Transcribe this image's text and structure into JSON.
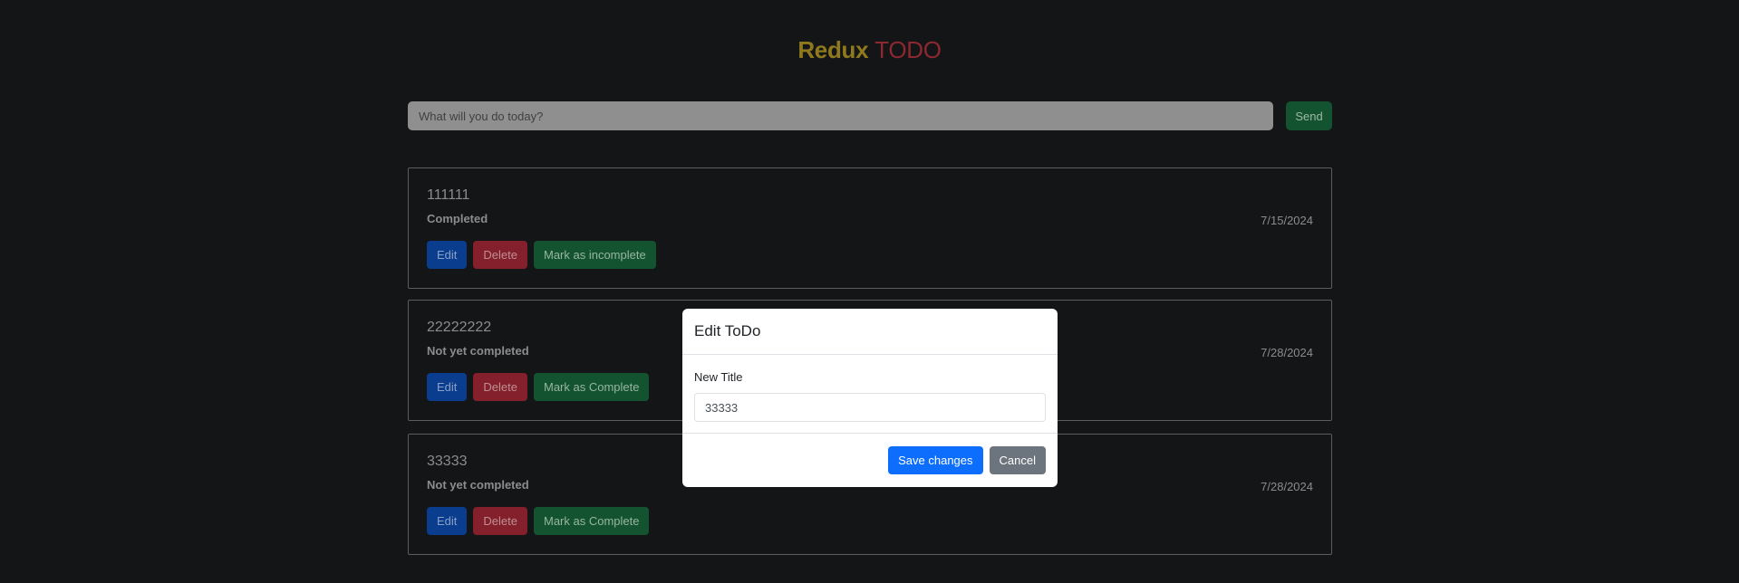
{
  "header": {
    "title_word1": "Redux",
    "title_word2": "TODO"
  },
  "add_form": {
    "placeholder": "What will you do today?",
    "value": "",
    "send_label": "Send"
  },
  "todos": [
    {
      "title": "111111",
      "status": "Completed",
      "date": "7/15/2024",
      "edit_label": "Edit",
      "delete_label": "Delete",
      "toggle_label": "Mark as incomplete"
    },
    {
      "title": "22222222",
      "status": "Not yet completed",
      "date": "7/28/2024",
      "edit_label": "Edit",
      "delete_label": "Delete",
      "toggle_label": "Mark as Complete"
    },
    {
      "title": "33333",
      "status": "Not yet completed",
      "date": "7/28/2024",
      "edit_label": "Edit",
      "delete_label": "Delete",
      "toggle_label": "Mark as Complete"
    }
  ],
  "modal": {
    "title": "Edit ToDo",
    "field_label": "New Title",
    "field_value": "33333",
    "save_label": "Save changes",
    "cancel_label": "Cancel"
  },
  "colors": {
    "background": "#141517",
    "title_word1": "#8e7a1d",
    "title_word2": "#8d2730",
    "primary": "#0d6efd",
    "secondary": "#6c757d",
    "success_dim": "#14532f",
    "danger_dim": "#84202b",
    "primary_dim": "#0a3d8e"
  }
}
